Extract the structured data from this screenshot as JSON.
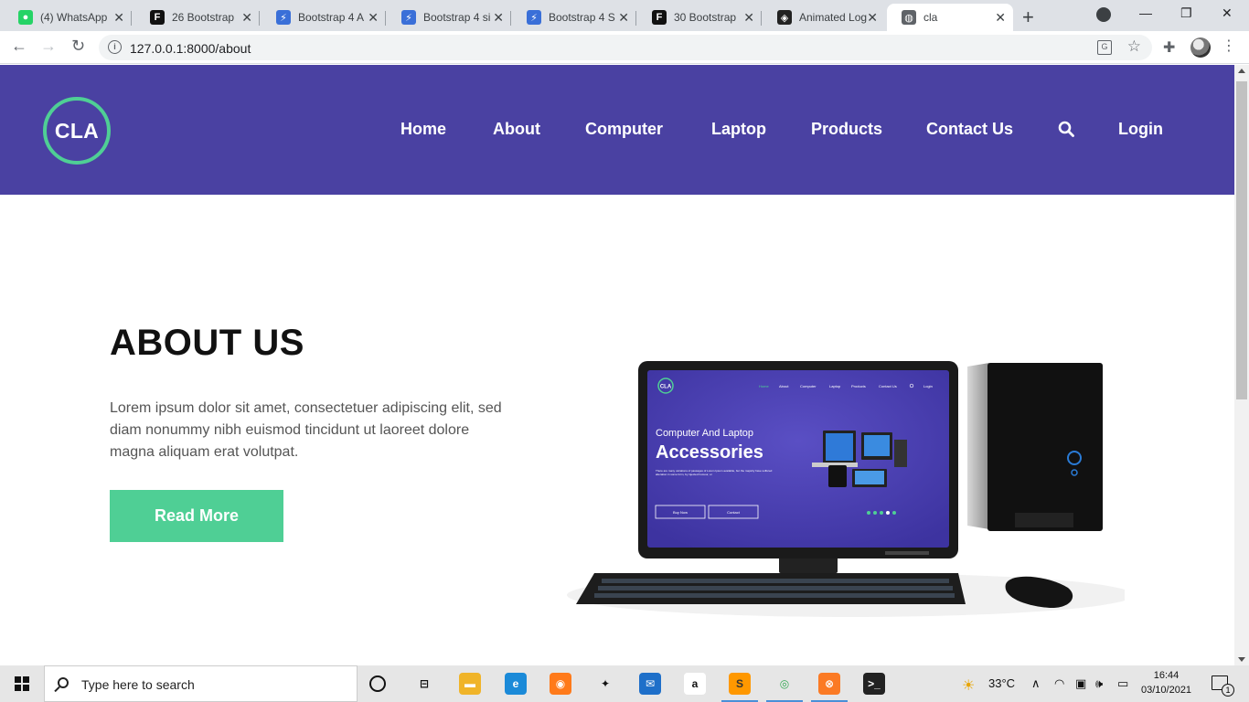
{
  "browser": {
    "tabs": [
      {
        "title": "(4) WhatsApp",
        "icon": "whatsapp-icon",
        "color": "#25d366",
        "glyph": "●"
      },
      {
        "title": "26 Bootstrap",
        "icon": "freefrontend-icon",
        "color": "#111111",
        "glyph": "F"
      },
      {
        "title": "Bootstrap 4 A",
        "icon": "bootstrapious-icon",
        "color": "#3a6fd8",
        "glyph": "⚡"
      },
      {
        "title": "Bootstrap 4 si",
        "icon": "bootstrapious-icon",
        "color": "#3a6fd8",
        "glyph": "⚡"
      },
      {
        "title": "Bootstrap 4 S",
        "icon": "bootstrapious-icon",
        "color": "#3a6fd8",
        "glyph": "⚡"
      },
      {
        "title": "30 Bootstrap",
        "icon": "freefrontend-icon",
        "color": "#111111",
        "glyph": "F"
      },
      {
        "title": "Animated Log",
        "icon": "codepen-icon",
        "color": "#222222",
        "glyph": "◈"
      },
      {
        "title": "cla",
        "icon": "globe-icon",
        "color": "#5f6368",
        "glyph": "◍"
      }
    ],
    "url": "127.0.0.1:8000/about"
  },
  "site": {
    "logo_text": "CLA",
    "nav": [
      "Home",
      "About",
      "Computer",
      "Laptop",
      "Products",
      "Contact Us",
      "Login"
    ],
    "about": {
      "title": "ABOUT US",
      "body": "Lorem ipsum dolor sit amet, consectetuer adipiscing elit, sed diam nonummy nibh euismod tincidunt ut laoreet dolore magna aliquam erat volutpat.",
      "button": "Read More"
    },
    "monitor": {
      "logo": "CLA",
      "nav": [
        "Home",
        "About",
        "Computer",
        "Laptop",
        "Products",
        "Contact Us",
        "Login"
      ],
      "kicker": "Computer And Laptop",
      "headline": "Accessories",
      "blurb": "There are many variations of passages of Lorem Ipsum available, but the majority have suffered alteration in some form, by injected humour, or",
      "btn1": "Buy Now",
      "btn2": "Contact"
    }
  },
  "colors": {
    "header_bg": "#4a41a2",
    "accent_green": "#4fcf95"
  },
  "taskbar": {
    "search_placeholder": "Type here to search",
    "temperature": "33°C",
    "time": "16:44",
    "date": "03/10/2021",
    "notifications": "1",
    "apps": [
      {
        "name": "task-view-icon",
        "glyph": "⊟",
        "color": "#e6e6e6",
        "text": "#111"
      },
      {
        "name": "file-explorer-icon",
        "glyph": "▬",
        "color": "#f0b429",
        "text": "#fff"
      },
      {
        "name": "edge-icon",
        "glyph": "e",
        "color": "#1b8ad8",
        "text": "#fff"
      },
      {
        "name": "firefox-icon",
        "glyph": "◉",
        "color": "#ff7a1a",
        "text": "#fff"
      },
      {
        "name": "dropbox-icon",
        "glyph": "✦",
        "color": "#e6e6e6",
        "text": "#111"
      },
      {
        "name": "mail-icon",
        "glyph": "✉",
        "color": "#1e6fc9",
        "text": "#fff"
      },
      {
        "name": "amazon-icon",
        "glyph": "a",
        "color": "#ffffff",
        "text": "#111"
      },
      {
        "name": "sublime-text-icon",
        "glyph": "S",
        "color": "#ff9800",
        "text": "#333"
      },
      {
        "name": "chrome-icon",
        "glyph": "◎",
        "color": "#e6e6e6",
        "text": "#34a853"
      },
      {
        "name": "xampp-icon",
        "glyph": "⊗",
        "color": "#fb7a24",
        "text": "#fff"
      },
      {
        "name": "terminal-icon",
        "glyph": ">_",
        "color": "#222222",
        "text": "#fff"
      }
    ]
  }
}
